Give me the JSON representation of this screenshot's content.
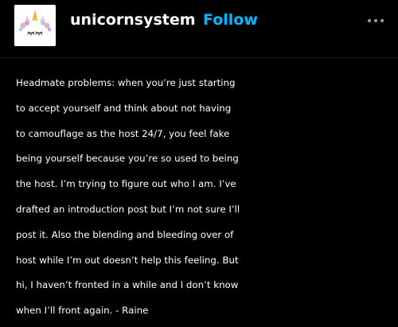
{
  "post": {
    "author": {
      "username": "unicornsystem",
      "follow_label": "Follow",
      "avatar_icon": "unicorn-avatar-icon"
    },
    "more_icon": "more-options-icon",
    "colors": {
      "background": "#000000",
      "text": "#ffffff",
      "follow": "#00b8ff"
    },
    "body_lines": [
      "Headmate problems: when you’re just starting",
      "to accept yourself and think about not having",
      "to camouflage as the host 24/7, you feel fake",
      "being yourself because you’re so used to being",
      "the host. I’m trying to figure out who I am. I’ve",
      "drafted an introduction post but I’m not sure I’ll",
      "post it. Also the blending and bleeding over of",
      "host while I’m out doesn’t help this feeling. But",
      "hi, I haven’t fronted in a while and I don’t know",
      "when I’ll front again. - Raine"
    ]
  }
}
